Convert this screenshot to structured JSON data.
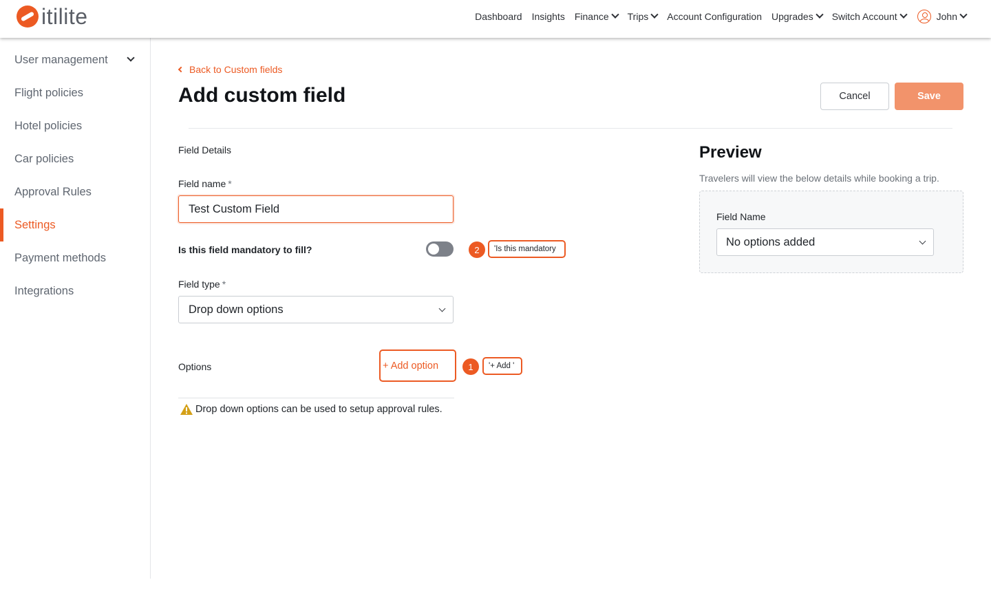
{
  "app": {
    "brand": "itilite",
    "brand_color": "#ec5a23"
  },
  "nav": {
    "items": [
      {
        "label": "Dashboard",
        "dropdown": false
      },
      {
        "label": "Insights",
        "dropdown": false
      },
      {
        "label": "Finance",
        "dropdown": true
      },
      {
        "label": "Trips",
        "dropdown": true
      },
      {
        "label": "Account Configuration",
        "dropdown": false
      },
      {
        "label": "Upgrades",
        "dropdown": true
      },
      {
        "label": "Switch Account",
        "dropdown": true
      }
    ],
    "user": "John"
  },
  "sidebar": {
    "items": [
      {
        "label": "User management",
        "active": false,
        "expandable": true
      },
      {
        "label": "Flight policies",
        "active": false
      },
      {
        "label": "Hotel policies",
        "active": false
      },
      {
        "label": "Car policies",
        "active": false
      },
      {
        "label": "Approval Rules",
        "active": false
      },
      {
        "label": "Settings",
        "active": true
      },
      {
        "label": "Payment methods",
        "active": false
      },
      {
        "label": "Integrations",
        "active": false
      }
    ]
  },
  "main": {
    "back_label": "Back to Custom fields",
    "title": "Add custom field",
    "cancel_label": "Cancel",
    "save_label": "Save",
    "section_label": "Field Details",
    "field_name_label": "Field name",
    "field_name_value": "Test Custom Field",
    "required_mark": "*",
    "mandatory_label": "Is this field mandatory to fill?",
    "mandatory_on": false,
    "field_type_label": "Field type",
    "field_type_value": "Drop down options",
    "options_label": "Options",
    "add_option_label": "+ Add option",
    "note": "Drop down options can be used to setup approval rules."
  },
  "callouts": {
    "one": {
      "number": "1",
      "text": "'+ Add '"
    },
    "two": {
      "number": "2",
      "text": "'Is this mandatory"
    }
  },
  "preview": {
    "title": "Preview",
    "description": "Travelers will view the below details while booking a trip.",
    "field_label": "Field Name",
    "select_value": "No options added"
  }
}
